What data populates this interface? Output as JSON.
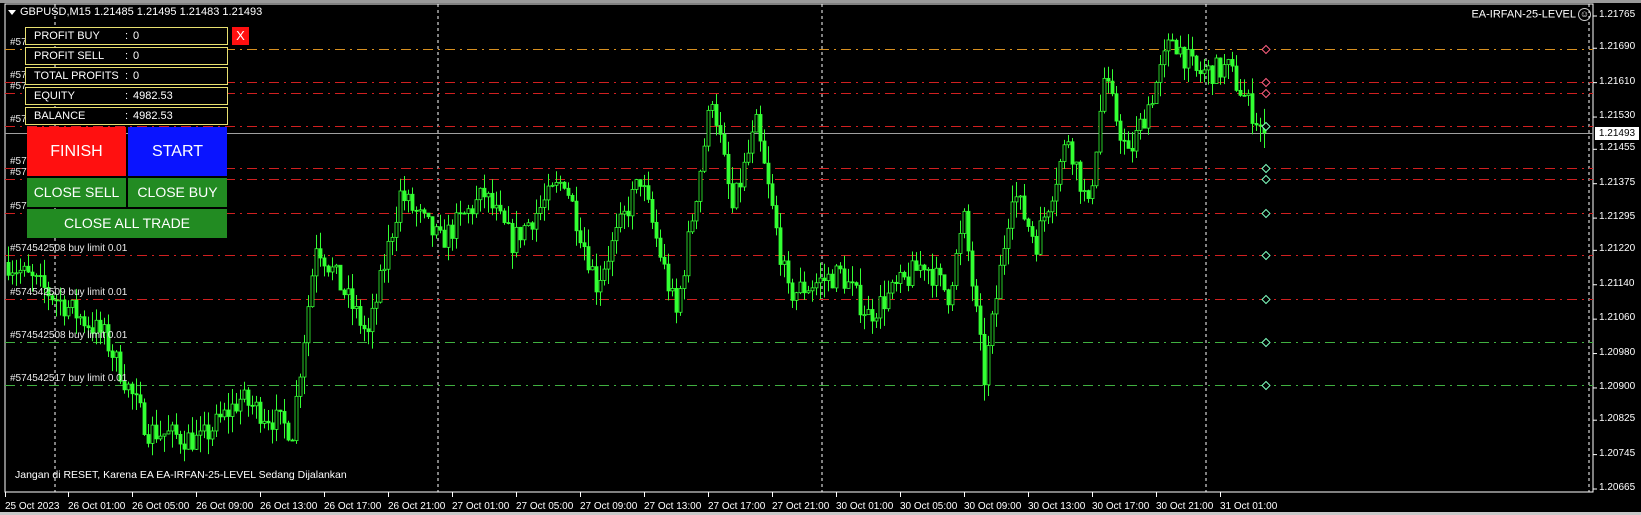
{
  "header": {
    "symbol_line": "GBPUSD,M15  1.21485 1.21495 1.21483 1.21493",
    "ea_name": "EA-IRFAN-25-LEVEL",
    "ea_icon": "smiley-icon"
  },
  "panel": {
    "rows": [
      {
        "label": "PROFIT BUY",
        "sep": ":",
        "value": "0"
      },
      {
        "label": "PROFIT SELL",
        "sep": ":",
        "value": "0"
      },
      {
        "label": "TOTAL PROFITS",
        "sep": ":",
        "value": "0"
      },
      {
        "label": "EQUITY",
        "sep": ":",
        "value": "4982.53"
      },
      {
        "label": "BALANCE",
        "sep": ":",
        "value": "4982.53"
      }
    ],
    "close_label": "X",
    "finish": "FINISH",
    "start": "START",
    "close_sell": "CLOSE SELL",
    "close_buy": "CLOSE BUY",
    "close_all": "CLOSE ALL TRADE",
    "colors": {
      "finish": "#ff1010",
      "start": "#0a14ff",
      "close": "#228b22"
    }
  },
  "warning": "Jangan di RESET, Karena EA EA-IRFAN-25-LEVEL Sedang Dijalankan",
  "price_axis": {
    "labels": [
      "1.21765",
      "1.21690",
      "1.21610",
      "1.21530",
      "1.21455",
      "1.21375",
      "1.21295",
      "1.21220",
      "1.21140",
      "1.21060",
      "1.20980",
      "1.20900",
      "1.20825",
      "1.20745",
      "1.20665"
    ],
    "current": "1.21493"
  },
  "time_axis": [
    "25 Oct 2023",
    "26 Oct 01:00",
    "26 Oct 05:00",
    "26 Oct 09:00",
    "26 Oct 13:00",
    "26 Oct 17:00",
    "26 Oct 21:00",
    "27 Oct 01:00",
    "27 Oct 05:00",
    "27 Oct 09:00",
    "27 Oct 13:00",
    "27 Oct 17:00",
    "27 Oct 21:00",
    "30 Oct 01:00",
    "30 Oct 05:00",
    "30 Oct 09:00",
    "30 Oct 13:00",
    "30 Oct 17:00",
    "30 Oct 21:00",
    "31 Oct 01:00"
  ],
  "order_lines": [
    {
      "price": 1.21688,
      "color": "#d89020",
      "label": "#57"
    },
    {
      "price": 1.21611,
      "color": "#d02020",
      "label": "#57"
    },
    {
      "price": 1.21587,
      "color": "#d02020",
      "label": "#57"
    },
    {
      "price": 1.21509,
      "color": "#d02020",
      "label": "#57"
    },
    {
      "price": 1.21411,
      "color": "#d02020",
      "label": "#57"
    },
    {
      "price": 1.21387,
      "color": "#d02020",
      "label": "#57"
    },
    {
      "price": 1.21306,
      "color": "#d02020",
      "label": "#57"
    },
    {
      "price": 1.21209,
      "color": "#d02020",
      "label": "#574542508 buy limit 0.01"
    },
    {
      "price": 1.21106,
      "color": "#d02020",
      "label": "#574542509 buy limit 0.01"
    },
    {
      "price": 1.21006,
      "color": "#40b040",
      "label": "#574542508 buy limit 0.01"
    },
    {
      "price": 1.20906,
      "color": "#40b040",
      "label": "#574542517 buy limit 0.01"
    }
  ],
  "chart_data": {
    "type": "candlestick",
    "symbol": "GBPUSD",
    "timeframe": "M15",
    "ylim": [
      1.20665,
      1.21765
    ],
    "current_price": 1.21493,
    "path": [
      [
        0,
        1.21192
      ],
      [
        14,
        1.21094
      ],
      [
        24,
        1.21021
      ],
      [
        35,
        1.20801
      ],
      [
        48,
        1.20777
      ],
      [
        58,
        1.20874
      ],
      [
        71,
        1.20801
      ],
      [
        77,
        1.2124
      ],
      [
        90,
        1.21021
      ],
      [
        98,
        1.2135
      ],
      [
        108,
        1.2124
      ],
      [
        119,
        1.2135
      ],
      [
        126,
        1.2124
      ],
      [
        139,
        1.21387
      ],
      [
        147,
        1.21143
      ],
      [
        158,
        1.21387
      ],
      [
        167,
        1.2107
      ],
      [
        176,
        1.21582
      ],
      [
        181,
        1.21314
      ],
      [
        187,
        1.21509
      ],
      [
        195,
        1.21118
      ],
      [
        208,
        1.21167
      ],
      [
        215,
        1.2107
      ],
      [
        229,
        1.21192
      ],
      [
        235,
        1.21118
      ],
      [
        239,
        1.21289
      ],
      [
        244,
        1.20923
      ],
      [
        251,
        1.21362
      ],
      [
        257,
        1.2124
      ],
      [
        265,
        1.21484
      ],
      [
        270,
        1.21314
      ],
      [
        274,
        1.21619
      ],
      [
        280,
        1.21436
      ],
      [
        286,
        1.21582
      ],
      [
        291,
        1.21716
      ],
      [
        297,
        1.21631
      ],
      [
        305,
        1.21643
      ],
      [
        314,
        1.21493
      ]
    ]
  }
}
